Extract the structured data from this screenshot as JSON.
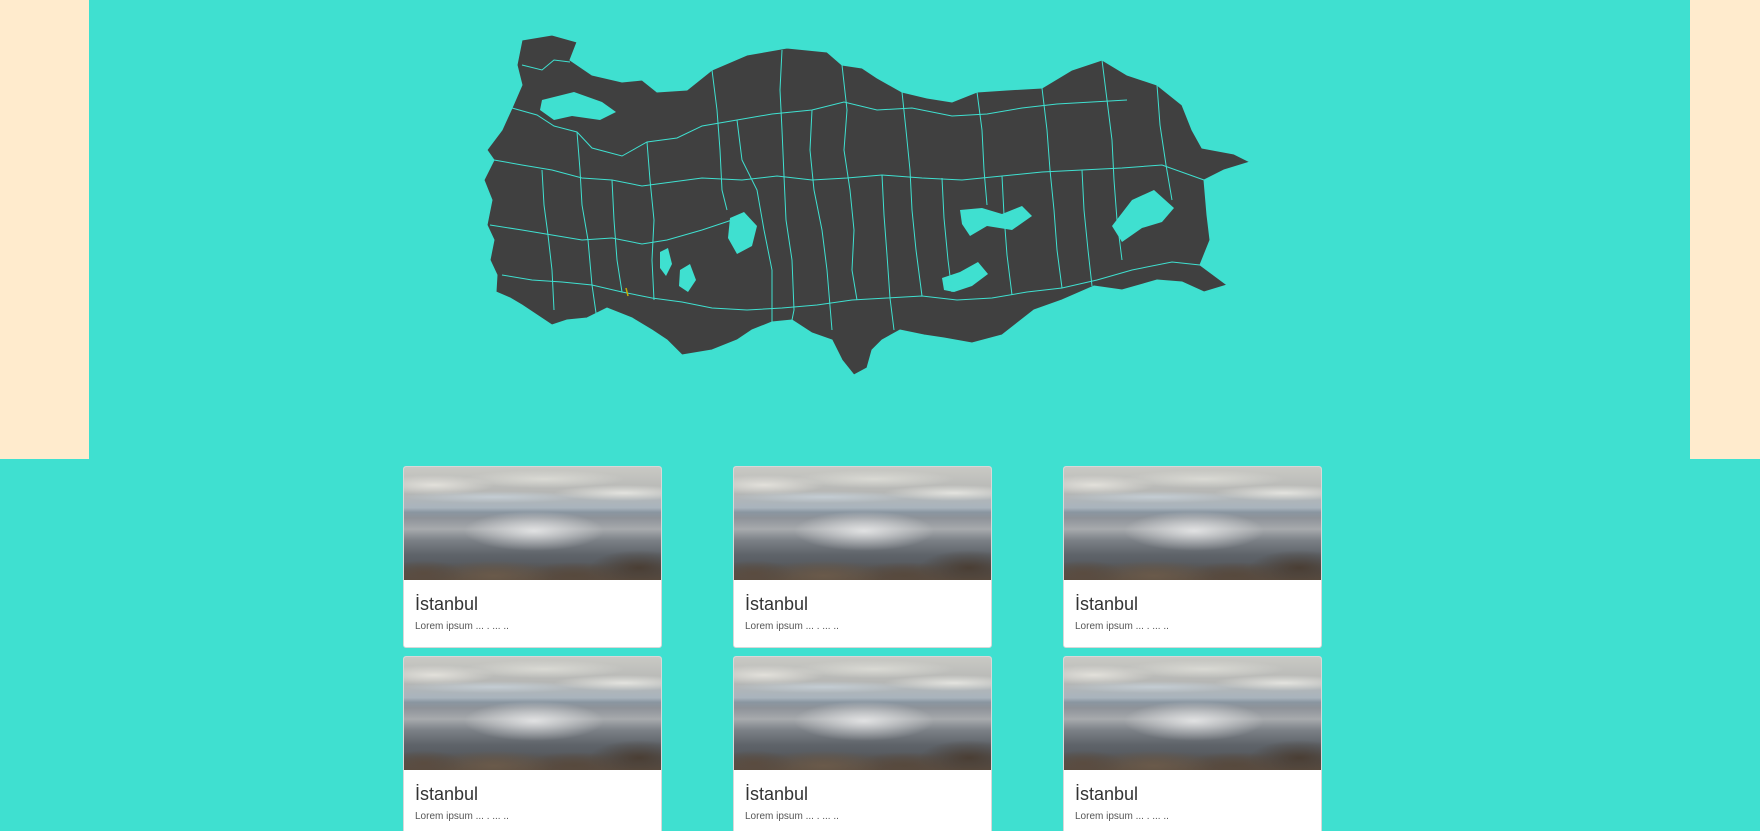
{
  "colors": {
    "background": "#3fe0d0",
    "side_panels": "#ffebcd",
    "map_fill": "#404040",
    "map_borders": "#3fe0d0",
    "card_background": "#ffffff"
  },
  "map": {
    "country": "Turkey",
    "style": "province-outline-map"
  },
  "cards": [
    {
      "title": "İstanbul",
      "text": "Lorem ipsum ... . ... ..",
      "image": "sea-shore-photo"
    },
    {
      "title": "İstanbul",
      "text": "Lorem ipsum ... . ... ..",
      "image": "sea-shore-photo"
    },
    {
      "title": "İstanbul",
      "text": "Lorem ipsum ... . ... ..",
      "image": "sea-shore-photo"
    },
    {
      "title": "İstanbul",
      "text": "Lorem ipsum ... . ... ..",
      "image": "sea-shore-photo"
    },
    {
      "title": "İstanbul",
      "text": "Lorem ipsum ... . ... ..",
      "image": "sea-shore-photo"
    },
    {
      "title": "İstanbul",
      "text": "Lorem ipsum ... . ... ..",
      "image": "sea-shore-photo"
    }
  ]
}
